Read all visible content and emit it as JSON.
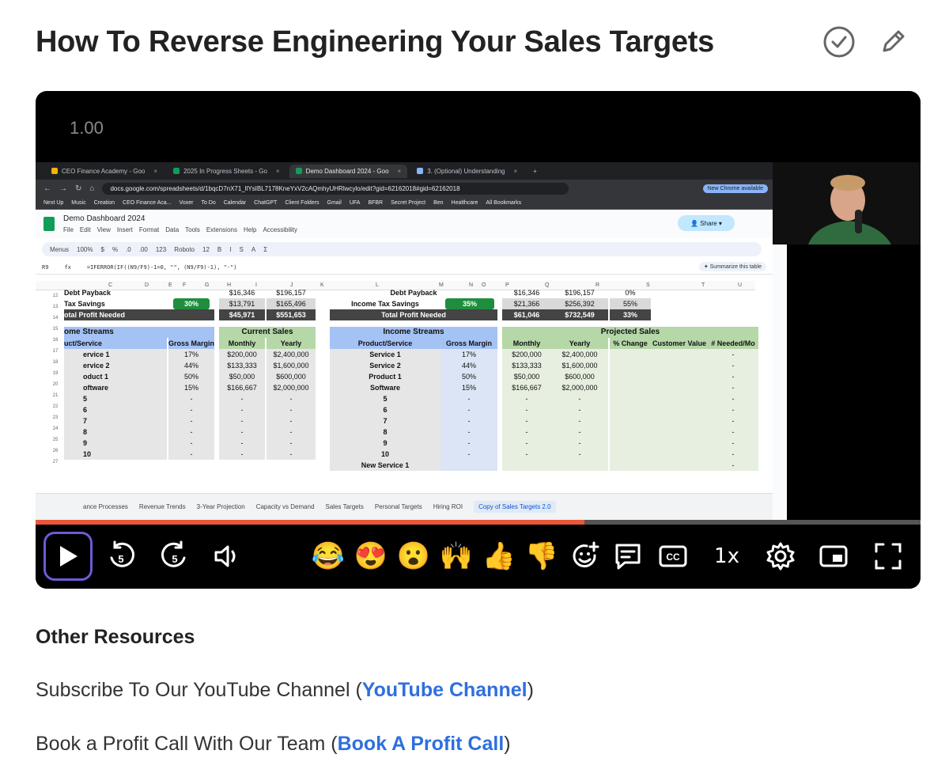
{
  "page": {
    "title": "How To Reverse Engineering Your Sales Targets"
  },
  "player": {
    "speed_overlay": "1.00",
    "progress_fraction": 0.62,
    "speed_button": "1x",
    "emojis": [
      "😂",
      "😍",
      "😮",
      "🙌",
      "👍",
      "👎"
    ]
  },
  "browser": {
    "tabs": [
      "CEO Finance Academy - Goo",
      "2025 In Progress Sheets - Go",
      "Demo Dashboard 2024 - Goo",
      "3. (Optional) Understanding"
    ],
    "url": "docs.google.com/spreadsheets/d/1bqcD7nX71_llYsIBL7178KneYxV2cAQmhyUHRlwcylo/edit?gid=62162018#gid=62162018",
    "chrome_notice": "New Chrome available",
    "bookmarks": [
      "Next Up",
      "Music",
      "Creation",
      "CEO Finance Aca...",
      "Voxer",
      "To Do",
      "Calendar",
      "ChatGPT",
      "Client Folders",
      "Gmail",
      "UFA",
      "BFBR",
      "Secret Project",
      "Ben",
      "Healthcare",
      "All Bookmarks"
    ]
  },
  "sheet": {
    "doc_title": "Demo Dashboard 2024",
    "menu": [
      "File",
      "Edit",
      "View",
      "Insert",
      "Format",
      "Data",
      "Tools",
      "Extensions",
      "Help",
      "Accessibility"
    ],
    "share_label": "Share",
    "toolbar_items": [
      "Menus",
      "100%",
      "$",
      "%",
      ".0",
      ".00",
      "123",
      "Roboto",
      "12",
      "B",
      "I",
      "S",
      "A",
      "Σ"
    ],
    "cell_ref": "R9",
    "formula": "=IFERROR(IF((N9/F9)-1=0, \"\", (N9/F9)-1), \"-\")",
    "summarize_label": "✦ Summarize this table",
    "col_letters": [
      "C",
      "D",
      "E",
      "F",
      "G",
      "H",
      "I",
      "J",
      "K",
      "L",
      "M",
      "N",
      "O",
      "P",
      "Q",
      "R",
      "S",
      "T",
      "U"
    ],
    "row_numbers": [
      "12",
      "13",
      "14",
      "15",
      "16",
      "17",
      "18",
      "19",
      "20",
      "21",
      "22",
      "23",
      "24",
      "25",
      "26",
      "27"
    ],
    "left": {
      "debt_payback": "Debt Payback",
      "debt_monthly": "$16,346",
      "debt_yearly": "$196,157",
      "tax_label": "Tax Savings",
      "tax_pct": "30%",
      "tax_monthly": "$13,791",
      "tax_yearly": "$165,496",
      "total_label": "otal Profit Needed",
      "total_monthly": "$45,971",
      "total_yearly": "$551,653",
      "streams_header": "ome Streams",
      "current_sales_header": "Current Sales",
      "col_product": "uct/Service",
      "col_margin": "Gross Margin",
      "col_monthly": "Monthly",
      "col_yearly": "Yearly",
      "rows": [
        {
          "name": "ervice 1",
          "margin": "17%",
          "monthly": "$200,000",
          "yearly": "$2,400,000"
        },
        {
          "name": "ervice 2",
          "margin": "44%",
          "monthly": "$133,333",
          "yearly": "$1,600,000"
        },
        {
          "name": "oduct 1",
          "margin": "50%",
          "monthly": "$50,000",
          "yearly": "$600,000"
        },
        {
          "name": "oftware",
          "margin": "15%",
          "monthly": "$166,667",
          "yearly": "$2,000,000"
        },
        {
          "name": "5",
          "margin": "-",
          "monthly": "-",
          "yearly": "-"
        },
        {
          "name": "6",
          "margin": "-",
          "monthly": "-",
          "yearly": "-"
        },
        {
          "name": "7",
          "margin": "-",
          "monthly": "-",
          "yearly": "-"
        },
        {
          "name": "8",
          "margin": "-",
          "monthly": "-",
          "yearly": "-"
        },
        {
          "name": "9",
          "margin": "-",
          "monthly": "-",
          "yearly": "-"
        },
        {
          "name": "10",
          "margin": "-",
          "monthly": "-",
          "yearly": "-"
        }
      ]
    },
    "right": {
      "debt_payback": "Debt Payback",
      "debt_monthly": "$16,346",
      "debt_yearly": "$196,157",
      "debt_pct": "0%",
      "tax_label": "Income Tax Savings",
      "tax_pct": "35%",
      "tax_monthly": "$21,366",
      "tax_yearly": "$256,392",
      "tax_change": "55%",
      "total_label": "Total Profit Needed",
      "total_monthly": "$61,046",
      "total_yearly": "$732,549",
      "total_change": "33%",
      "streams_header": "Income Streams",
      "projected_header": "Projected Sales",
      "col_product": "Product/Service",
      "col_margin": "Gross Margin",
      "col_monthly": "Monthly",
      "col_yearly": "Yearly",
      "col_change": "% Change",
      "col_customer": "Customer Value",
      "col_needed": "# Needed/Mo",
      "rows": [
        {
          "name": "Service 1",
          "margin": "17%",
          "monthly": "$200,000",
          "yearly": "$2,400,000",
          "needed": "-"
        },
        {
          "name": "Service 2",
          "margin": "44%",
          "monthly": "$133,333",
          "yearly": "$1,600,000",
          "needed": "-"
        },
        {
          "name": "Product 1",
          "margin": "50%",
          "monthly": "$50,000",
          "yearly": "$600,000",
          "needed": "-"
        },
        {
          "name": "Software",
          "margin": "15%",
          "monthly": "$166,667",
          "yearly": "$2,000,000",
          "needed": "-"
        },
        {
          "name": "5",
          "margin": "-",
          "monthly": "-",
          "yearly": "-",
          "needed": "-"
        },
        {
          "name": "6",
          "margin": "-",
          "monthly": "-",
          "yearly": "-",
          "needed": "-"
        },
        {
          "name": "7",
          "margin": "-",
          "monthly": "-",
          "yearly": "-",
          "needed": "-"
        },
        {
          "name": "8",
          "margin": "-",
          "monthly": "-",
          "yearly": "-",
          "needed": "-"
        },
        {
          "name": "9",
          "margin": "-",
          "monthly": "-",
          "yearly": "-",
          "needed": "-"
        },
        {
          "name": "10",
          "margin": "-",
          "monthly": "-",
          "yearly": "-",
          "needed": "-"
        },
        {
          "name": "New Service 1",
          "margin": "",
          "monthly": "",
          "yearly": "",
          "needed": "-"
        }
      ]
    },
    "sheet_tabs": [
      "ance Processes",
      "Revenue Trends",
      "3-Year Projection",
      "Capacity vs Demand",
      "Sales Targets",
      "Personal Targets",
      "Hiring ROI",
      "Copy of Sales Targets 2.0"
    ]
  },
  "resources": {
    "heading": "Other Resources",
    "youtube_prefix": "Subscribe To Our YouTube Channel (",
    "youtube_link": "YouTube Channel",
    "youtube_suffix": ")",
    "call_prefix": "Book a Profit Call With Our Team (",
    "call_link": "Book A Profit Call",
    "call_suffix": ")"
  },
  "colors": {
    "link": "#2f6fde",
    "progress": "#e8573a",
    "play_ring": "#6b5bd6",
    "blue_header": "#a4c2f4",
    "green_header": "#b6d7a8",
    "dark_row": "#444444"
  }
}
